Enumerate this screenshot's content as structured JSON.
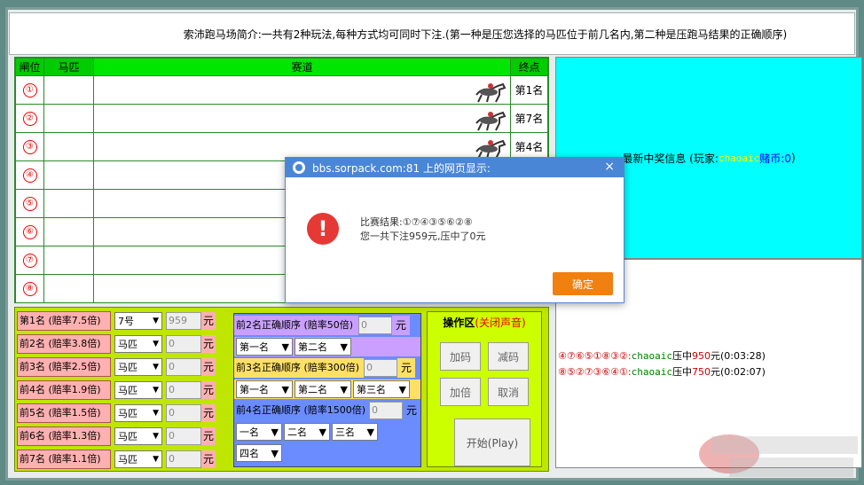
{
  "intro": {
    "text": "索沛跑马场简介:一共有2种玩法,每种方式均可同时下注.(第一种是压您选择的马匹位于前几名内,第二种是压跑马结果的正确顺序)"
  },
  "race": {
    "headers": {
      "gate": "闸位",
      "horse": "马匹",
      "lane": "赛道",
      "finish": "终点"
    },
    "lanes": [
      {
        "gate": "①",
        "finish": "第1名"
      },
      {
        "gate": "②",
        "finish": "第7名"
      },
      {
        "gate": "③",
        "finish": "第4名"
      },
      {
        "gate": "④",
        "finish": ""
      },
      {
        "gate": "⑤",
        "finish": ""
      },
      {
        "gate": "⑥",
        "finish": ""
      },
      {
        "gate": "⑦",
        "finish": ""
      },
      {
        "gate": "⑧",
        "finish": ""
      }
    ]
  },
  "info": {
    "prefix": "最新中奖信息 (玩家:",
    "player": "chaoaic",
    "coins_label": "赌币:0",
    "suffix": ")"
  },
  "history": [
    {
      "seq": "④⑦⑥⑤①⑧③②",
      "player": "chaoaic",
      "txt": "压中",
      "amount": "950",
      "unit": "元",
      "time": "(0:03:28)"
    },
    {
      "seq": "⑧⑤②⑦③⑥④①",
      "player": "chaoaic",
      "txt": "压中",
      "amount": "750",
      "unit": "元",
      "time": "(0:02:07)"
    }
  ],
  "bets": {
    "rows": [
      {
        "label": "第1名 (赔率7.5倍)",
        "select": "7号",
        "amount": "959",
        "unit": "元"
      },
      {
        "label": "前2名 (赔率3.8倍)",
        "select": "马匹",
        "amount": "0",
        "unit": "元"
      },
      {
        "label": "前3名 (赔率2.5倍)",
        "select": "马匹",
        "amount": "0",
        "unit": "元"
      },
      {
        "label": "前4名 (赔率1.9倍)",
        "select": "马匹",
        "amount": "0",
        "unit": "元"
      },
      {
        "label": "前5名 (赔率1.5倍)",
        "select": "马匹",
        "amount": "0",
        "unit": "元"
      },
      {
        "label": "前6名 (赔率1.3倍)",
        "select": "马匹",
        "amount": "0",
        "unit": "元"
      },
      {
        "label": "前7名 (赔率1.1倍)",
        "select": "马匹",
        "amount": "0",
        "unit": "元"
      }
    ],
    "order2": {
      "label": "前2名正确顺序 (赔率50倍)",
      "amount": "0",
      "unit": "元",
      "s1": "第一名",
      "s2": "第二名"
    },
    "order3": {
      "label": "前3名正确顺序 (赔率300倍)",
      "amount": "0",
      "unit": "元",
      "s1": "第一名",
      "s2": "第二名",
      "s3": "第三名"
    },
    "order4": {
      "label": "前4名正确顺序 (赔率1500倍)",
      "amount": "0",
      "unit": "元",
      "s1": "一名",
      "s2": "二名",
      "s3": "三名",
      "s4": "四名"
    }
  },
  "ops": {
    "title": "操作区",
    "sound": "(关闭声音)",
    "add_code": "加码",
    "sub_code": "减码",
    "double": "加倍",
    "cancel": "取消",
    "play": "开始(Play)"
  },
  "dialog": {
    "title": "bbs.sorpack.com:81 上的网页显示:",
    "result_line": "比赛结果:①⑦④③⑤⑥②⑧",
    "summary_line": "您一共下注959元,压中了0元",
    "ok": "确定",
    "close": "×"
  },
  "colors": {
    "lane_header": "#00e600",
    "info_bg": "#00ffff",
    "bet_bg": "#bfe600",
    "dialog_title": "#4a86d6",
    "ok_button": "#f08010"
  }
}
